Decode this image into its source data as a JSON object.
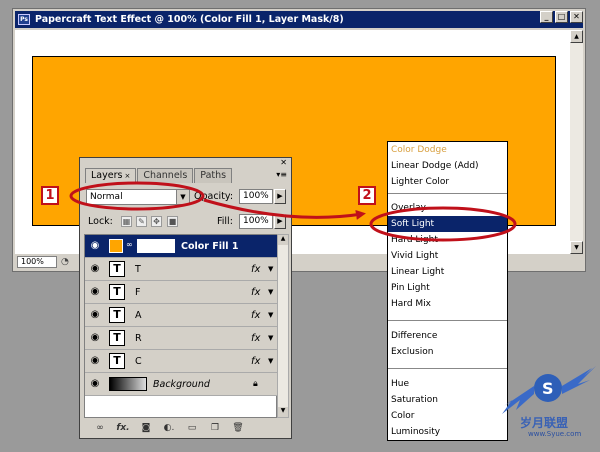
{
  "window": {
    "title": "Papercraft Text Effect @ 100% (Color Fill 1, Layer Mask/8)",
    "app_icon": "Ps",
    "zoom": "100%",
    "colors": {
      "canvas_fill": "#ffa500",
      "title_bg": "#0a246a"
    }
  },
  "layers_panel": {
    "tabs": [
      {
        "label": "Layers",
        "active": true
      },
      {
        "label": "Channels",
        "active": false
      },
      {
        "label": "Paths",
        "active": false
      }
    ],
    "blend_mode": "Normal",
    "opacity_label": "Opacity:",
    "opacity": "100%",
    "lock_label": "Lock:",
    "fill_label": "Fill:",
    "fill": "100%",
    "layers": [
      {
        "name": "Color Fill 1",
        "selected": true,
        "type": "fill"
      },
      {
        "name": "T",
        "type": "text",
        "fx": "fx"
      },
      {
        "name": "F",
        "type": "text",
        "fx": "fx"
      },
      {
        "name": "A",
        "type": "text",
        "fx": "fx"
      },
      {
        "name": "R",
        "type": "text",
        "fx": "fx"
      },
      {
        "name": "C",
        "type": "text",
        "fx": "fx"
      },
      {
        "name": "Background",
        "type": "background",
        "locked": true
      }
    ],
    "text_thumb": "T",
    "bottom_icons": [
      "link-icon",
      "fx-icon",
      "mask-icon",
      "adjustment-icon",
      "folder-icon",
      "new-layer-icon",
      "trash-icon"
    ]
  },
  "blend_menu": {
    "items": [
      {
        "label": "Color Dodge",
        "faded": true
      },
      {
        "label": "Linear Dodge (Add)"
      },
      {
        "label": "Lighter Color"
      },
      {
        "label": "Overlay"
      },
      {
        "label": "Soft Light",
        "selected": true
      },
      {
        "label": "Hard Light"
      },
      {
        "label": "Vivid Light"
      },
      {
        "label": "Linear Light"
      },
      {
        "label": "Pin Light"
      },
      {
        "label": "Hard Mix"
      },
      {
        "label": "Difference"
      },
      {
        "label": "Exclusion"
      },
      {
        "label": "Hue"
      },
      {
        "label": "Saturation"
      },
      {
        "label": "Color"
      },
      {
        "label": "Luminosity"
      }
    ]
  },
  "annotations": {
    "step1": "1",
    "step2": "2",
    "accent": "#c0101a"
  },
  "watermark": {
    "text": "岁月联盟",
    "url": "www.Syue.com"
  }
}
